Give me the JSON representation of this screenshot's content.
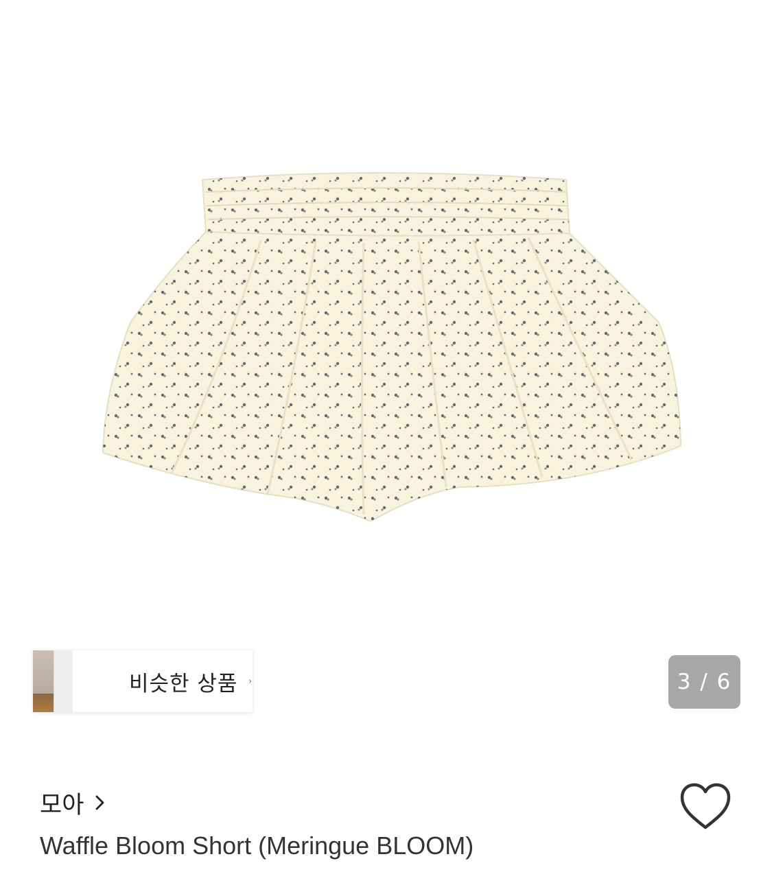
{
  "gallery": {
    "current_page": "3",
    "total_pages": "6",
    "counter_text": "3 / 6",
    "similar_products_label": "비슷한 상품"
  },
  "product": {
    "brand": "모아",
    "title": "Waffle Bloom Short (Meringue BLOOM)"
  },
  "icons": {
    "similar_chevron": "chevron-right-icon",
    "brand_chevron": "chevron-right-icon",
    "wishlist": "heart-outline-icon"
  },
  "colors": {
    "counter_bg": "#a7a7a7",
    "fabric": "#f7f3dc",
    "print": "#4a4f63"
  }
}
